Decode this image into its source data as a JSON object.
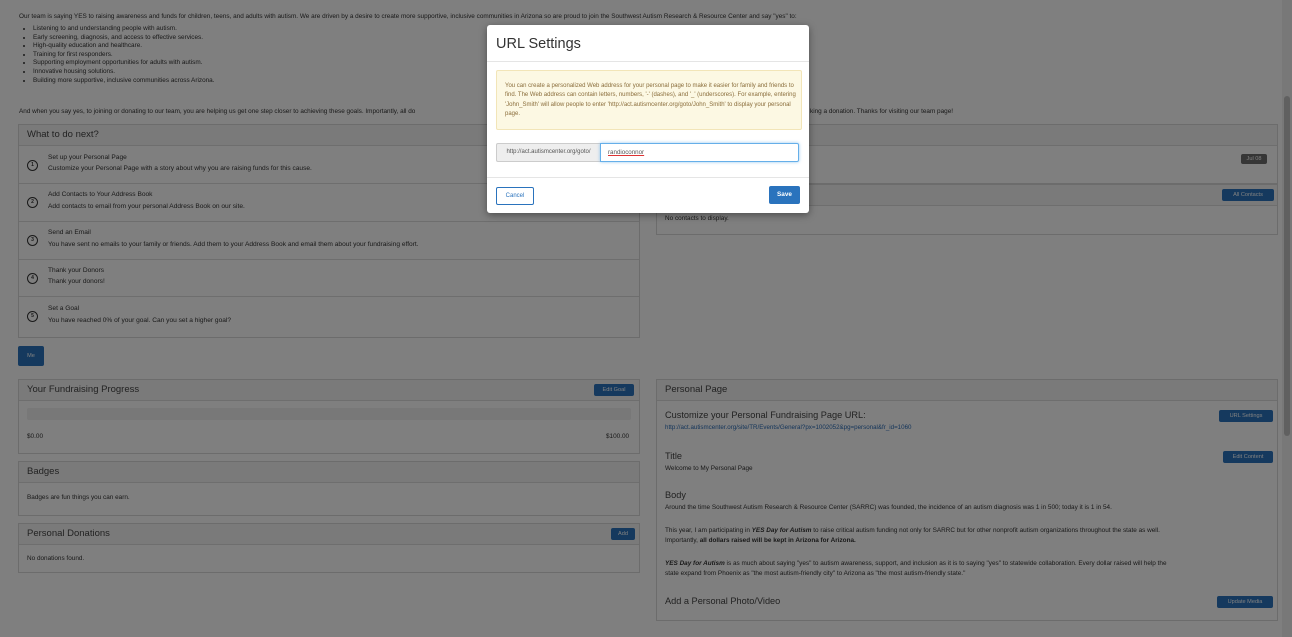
{
  "intro": {
    "paragraph1": "Our team is saying YES to raising awareness and funds for children, teens, and adults with autism. We are driven by a desire to create more supportive, inclusive communities in Arizona so are proud to join the Southwest Autism Research & Resource Center and say \"yes\" to:",
    "bullets": [
      "Listening to and understanding people with autism.",
      "Early screening, diagnosis, and access to effective services.",
      "High-quality education and healthcare.",
      "Training for first responders.",
      "Supporting employment opportunities for adults with autism.",
      "Innovative housing solutions.",
      "Building more supportive, inclusive communities across Arizona."
    ],
    "paragraph2_start": "And when you say yes, to joining or donating to our team, you are helping us get one step closer to achieving these goals. Importantly, all do",
    "paragraph2_end": "king a donation. Thanks for visiting our team page!"
  },
  "what_next": {
    "title": "What to do next?",
    "steps": [
      {
        "num": "1",
        "title": "Set up your Personal Page",
        "desc": "Customize your Personal Page with a story about why you are raising funds for this cause."
      },
      {
        "num": "2",
        "title": "Add Contacts to Your Address Book",
        "desc": "Add contacts to email from your personal Address Book on our site."
      },
      {
        "num": "3",
        "title": "Send an Email",
        "desc": "You have sent no emails to your family or friends. Add them to your Address Book and email them about your fundraising effort."
      },
      {
        "num": "4",
        "title": "Thank your Donors",
        "desc": "Thank your donors!"
      },
      {
        "num": "5",
        "title": "Set a Goal",
        "desc": "You have reached 0% of your goal. Can you set a higher goal?"
      }
    ]
  },
  "right_top": {
    "badge_btn": "Jul 08",
    "all_contacts_btn": "All Contacts",
    "no_contacts": "No contacts to display."
  },
  "me_tab": "Me",
  "progress": {
    "title": "Your Fundraising Progress",
    "edit_goal_btn": "Edit Goal",
    "raised": "$0.00",
    "goal": "$100.00",
    "fraction": 0
  },
  "badges": {
    "title": "Badges",
    "text": "Badges are fun things you can earn."
  },
  "donations": {
    "title": "Personal Donations",
    "add_btn": "Add",
    "text": "No donations found."
  },
  "personal_page": {
    "title": "Personal Page",
    "url_heading": "Customize your Personal Fundraising Page URL:",
    "url_btn": "URL Settings",
    "url_link": "http://act.autismcenter.org/site/TR/Events/General?px=1002052&pg=personal&fr_id=1060",
    "title_heading": "Title",
    "edit_content_btn": "Edit Content",
    "title_text": "Welcome to My Personal Page",
    "body_heading": "Body",
    "body_p1": "Around the time Southwest Autism Research & Resource Center (SARRC) was founded, the incidence of an autism diagnosis was 1 in 500; today it is 1 in 54.",
    "body_p2a": "This year, I am participating in ",
    "body_p2_em": "YES Day for Autism",
    "body_p2b": " to raise critical autism funding not only for SARRC but for other nonprofit autism organizations throughout the state as well.",
    "body_p2c": "Importantly, ",
    "body_p2_strong": "all dollars raised will be kept in Arizona for Arizona.",
    "body_p3_em": "YES Day for Autism",
    "body_p3a": " is as much about saying \"yes\" to autism awareness, support, and inclusion as it is to saying \"yes\" to statewide collaboration. Every dollar raised will help the",
    "body_p3b": "state expand from Phoenix as \"the most autism-friendly city\" to Arizona as \"the most autism-friendly state.\"",
    "photo_heading": "Add a Personal Photo/Video",
    "update_media_btn": "Update Media"
  },
  "modal": {
    "title": "URL Settings",
    "alert": "You can create a personalized Web address for your personal page to make it easier for family and friends to find. The Web address can contain letters, numbers, '-' (dashes), and '_' (underscores). For example, entering 'John_Smith' will allow people to enter 'http://act.autismcenter.org/goto/John_Smith' to display your personal page.",
    "url_prefix": "http://act.autismcenter.org/goto/",
    "url_value": "randioconnor",
    "cancel": "Cancel",
    "save": "Save"
  }
}
